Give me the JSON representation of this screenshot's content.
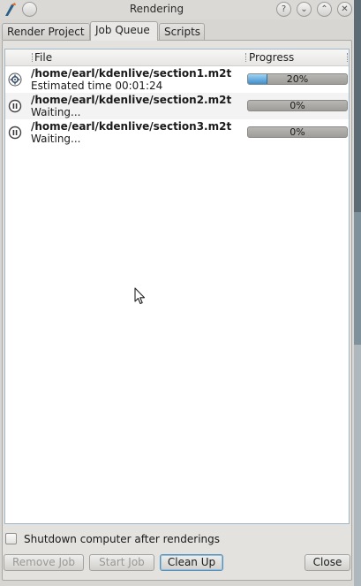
{
  "window": {
    "title": "Rendering",
    "buttons": {
      "help": "?",
      "min": "⌄",
      "max": "⌃",
      "close": "✕"
    }
  },
  "tabs": [
    {
      "label": "Render Project",
      "active": false
    },
    {
      "label": "Job Queue",
      "active": true
    },
    {
      "label": "Scripts",
      "active": false
    }
  ],
  "queue": {
    "columns": {
      "file": "File",
      "progress": "Progress"
    },
    "jobs": [
      {
        "file": "/home/earl/kdenlive/section1.m2t",
        "status": "Estimated time 00:01:24",
        "progress": 20,
        "progress_label": "20%",
        "icon": "render-icon"
      },
      {
        "file": "/home/earl/kdenlive/section2.m2t",
        "status": "Waiting...",
        "progress": 0,
        "progress_label": "0%",
        "icon": "pause-icon"
      },
      {
        "file": "/home/earl/kdenlive/section3.m2t",
        "status": "Waiting...",
        "progress": 0,
        "progress_label": "0%",
        "icon": "pause-icon"
      }
    ]
  },
  "options": {
    "shutdown_label": "Shutdown computer after renderings",
    "shutdown_checked": false
  },
  "actions": {
    "remove_job": "Remove Job",
    "start_job": "Start Job",
    "clean_up": "Clean Up",
    "close": "Close"
  },
  "colors": {
    "progress_fill": "#3d8fcc",
    "list_border": "#9fb7c6"
  }
}
